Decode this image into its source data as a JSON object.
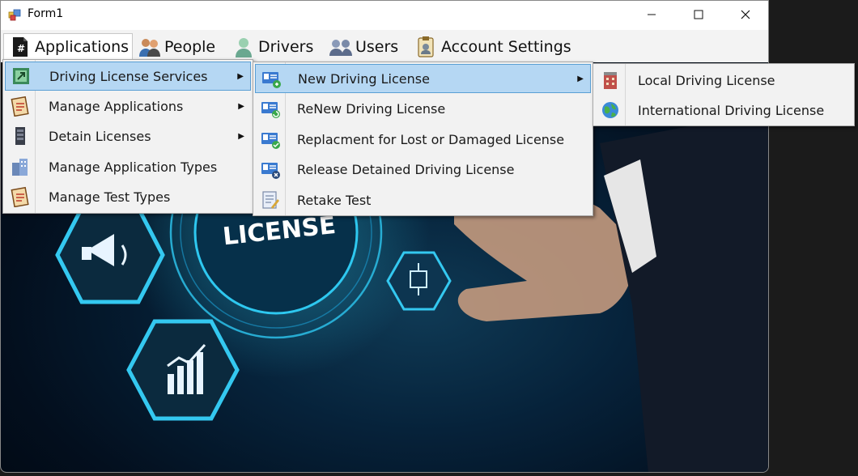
{
  "window": {
    "title": "Form1"
  },
  "menubar": {
    "items": [
      {
        "label": "Applications",
        "icon": "document-icon"
      },
      {
        "label": "People",
        "icon": "people-icon"
      },
      {
        "label": "Drivers",
        "icon": "driver-icon"
      },
      {
        "label": "Users",
        "icon": "users-icon"
      },
      {
        "label": "Account Settings",
        "icon": "account-settings-icon"
      }
    ]
  },
  "menu1": {
    "items": [
      {
        "label": "Driving License Services",
        "icon": "services-icon",
        "has_submenu": true,
        "selected": true
      },
      {
        "label": "Manage Applications",
        "icon": "applications-icon",
        "has_submenu": true
      },
      {
        "label": "Detain Licenses",
        "icon": "detain-icon",
        "has_submenu": true
      },
      {
        "label": "Manage Application Types",
        "icon": "application-types-icon"
      },
      {
        "label": "Manage Test Types",
        "icon": "test-types-icon"
      }
    ]
  },
  "menu2": {
    "items": [
      {
        "label": "New Driving License",
        "icon": "license-card-icon",
        "has_submenu": true,
        "selected": true
      },
      {
        "label": "ReNew Driving License",
        "icon": "license-card-icon"
      },
      {
        "label": "Replacment for Lost or Damaged License",
        "icon": "license-card-icon"
      },
      {
        "label": "Release Detained Driving License",
        "icon": "license-card-icon"
      },
      {
        "label": "Retake Test",
        "icon": "test-icon"
      }
    ]
  },
  "menu3": {
    "items": [
      {
        "label": "Local Driving License",
        "icon": "building-icon"
      },
      {
        "label": "International Driving License",
        "icon": "globe-icon"
      }
    ]
  },
  "background": {
    "text": "LICENSE"
  }
}
